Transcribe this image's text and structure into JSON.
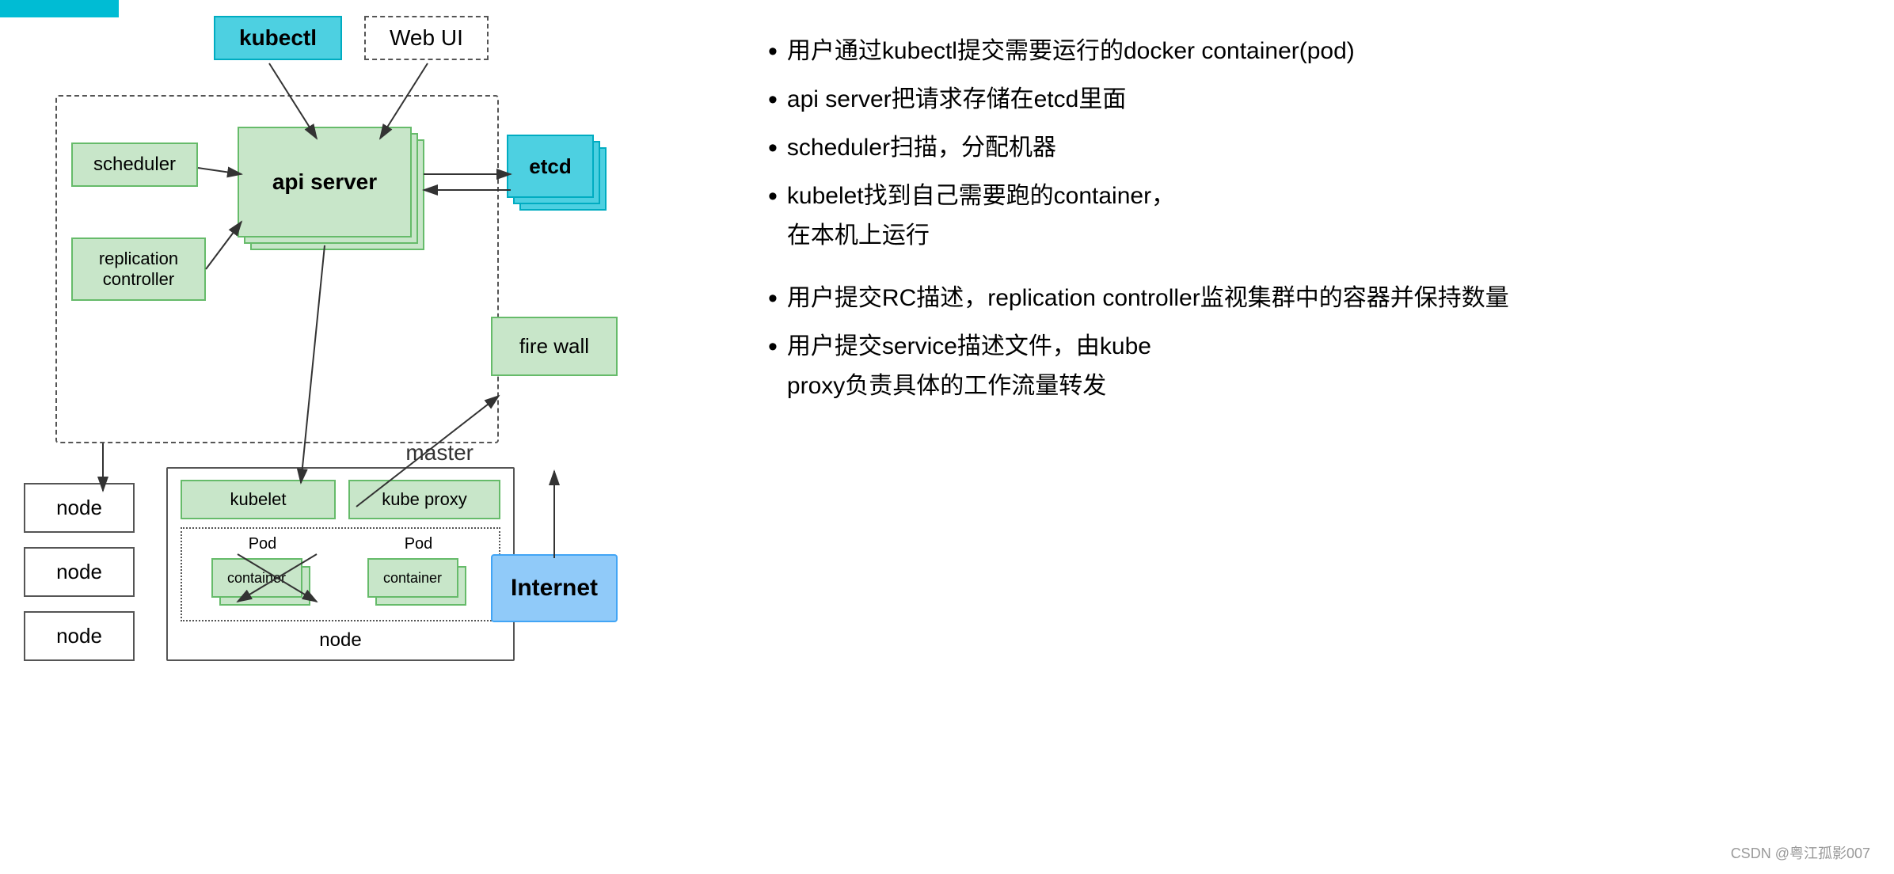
{
  "topbar": {
    "color": "#00bcd4"
  },
  "diagram": {
    "kubectl_label": "kubectl",
    "webui_label": "Web UI",
    "master_label": "master",
    "scheduler_label": "scheduler",
    "replication_label": "replication\ncontroller",
    "api_server_label": "api server",
    "etcd_label": "etcd",
    "firewall_label": "fire wall",
    "node_labels": [
      "node",
      "node",
      "node"
    ],
    "kubelet_label": "kubelet",
    "kube_proxy_label": "kube proxy",
    "pod_label1": "Pod",
    "pod_label2": "Pod",
    "container_label": "container",
    "node_bottom_label": "node",
    "internet_label": "Internet"
  },
  "bullets": [
    {
      "text": "用户通过kubectl提交需要运行的docker container(pod)"
    },
    {
      "text": "api server把请求存储在etcd里面"
    },
    {
      "text": "scheduler扫描，分配机器"
    },
    {
      "text": "kubelet找到自己需要跑的container，在本机上运行"
    },
    {
      "text": "用户提交RC描述，replication controller监视集群中的容器并保持数量"
    },
    {
      "text": "用户提交service描述文件，由kube proxy负责具体的工作流量转发"
    }
  ],
  "watermark": "CSDN @粤江孤影007"
}
